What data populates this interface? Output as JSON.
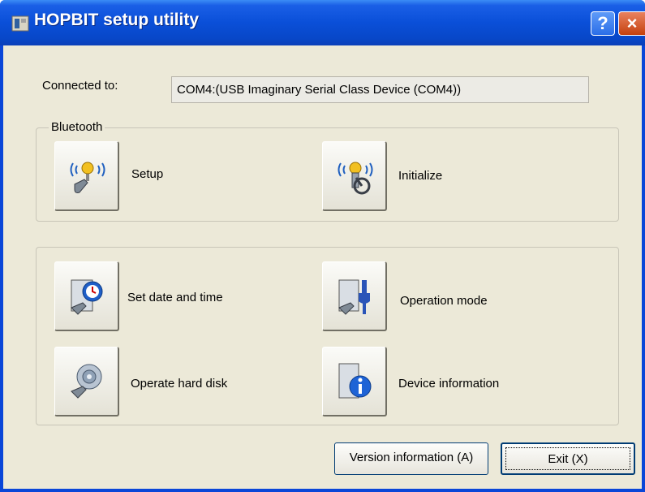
{
  "window": {
    "title": "HOPBIT setup utility"
  },
  "titlebar": {
    "help_label": "?",
    "close_label": "×"
  },
  "connection": {
    "label": "Connected to:",
    "value": "COM4:(USB Imaginary Serial Class Device (COM4))"
  },
  "bluetooth": {
    "group_title": "Bluetooth",
    "setup_label": "Setup",
    "initialize_label": "Initialize"
  },
  "tools": {
    "set_date_label": "Set date and time",
    "operation_mode_label": "Operation mode",
    "operate_disk_label": "Operate hard disk",
    "device_info_label": "Device information"
  },
  "footer": {
    "version_label": "Version information (A)",
    "exit_label": "Exit (X)"
  }
}
